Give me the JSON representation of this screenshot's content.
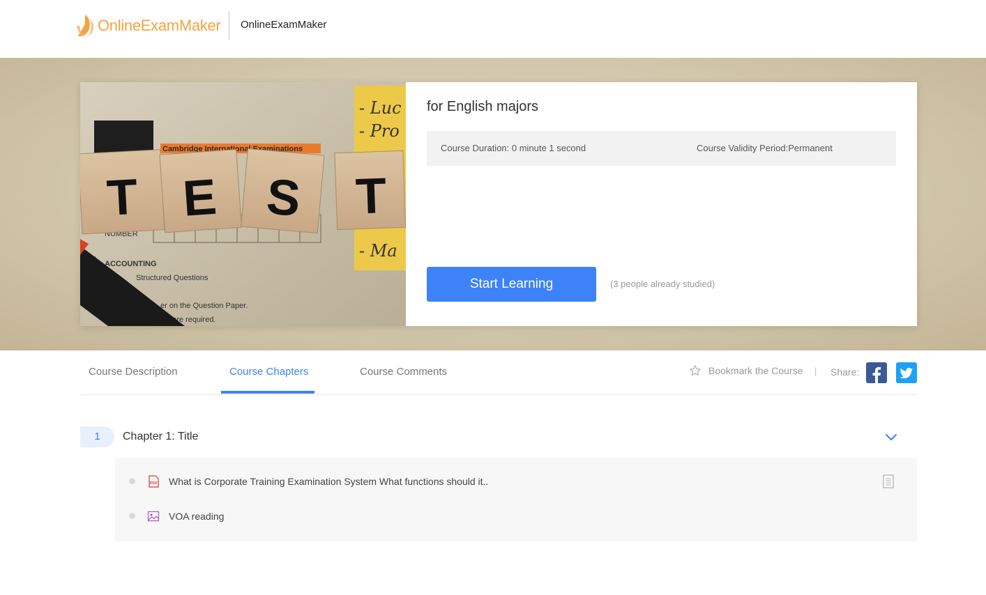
{
  "header": {
    "logo_text": "OnlineExamMaker",
    "site_name": "OnlineExamMaker"
  },
  "hero": {
    "course_title": "for English majors",
    "duration": "Course Duration: 0 minute 1 second",
    "validity": "Course Validity Period:Permanent",
    "start_button": "Start Learning",
    "studied_text": "(3 people already studied)",
    "image": {
      "tiles": [
        "T",
        "E",
        "S",
        "T"
      ],
      "paper_header": "Cambridge International Examinations",
      "paper_lines": [
        "NUMBER",
        "ACCOUNTING",
        "Structured Questions",
        "er on the Question Paper.",
        "als are required."
      ],
      "note_lines": [
        "- Luc",
        "- Pro",
        "- Ma"
      ]
    }
  },
  "tabs": {
    "items": [
      "Course Description",
      "Course Chapters",
      "Course Comments"
    ],
    "active": "Course Chapters",
    "bookmark": "Bookmark the Course",
    "separator": "|",
    "share": "Share:"
  },
  "chapter": {
    "number": "1",
    "title": "Chapter 1: Title",
    "lessons": [
      {
        "icon": "pdf-icon",
        "label": "What is Corporate Training Examination System What functions should it.."
      },
      {
        "icon": "image-icon",
        "label": "VOA reading"
      }
    ]
  },
  "colors": {
    "accent": "#3d82f7",
    "brand": "#f4a340",
    "facebook": "#3b5998",
    "twitter": "#1da1f2"
  }
}
